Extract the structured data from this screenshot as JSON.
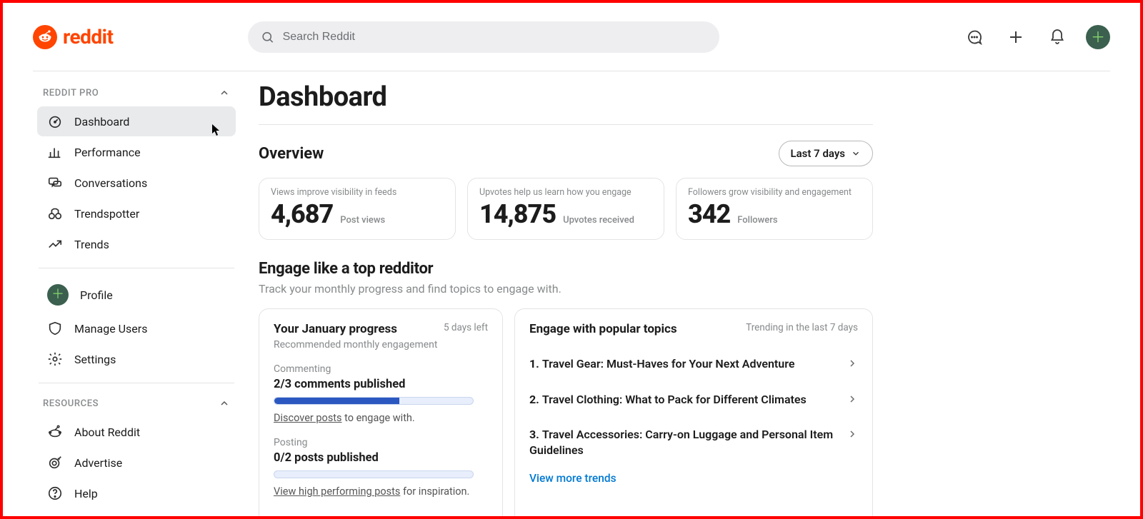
{
  "brand": {
    "name": "reddit"
  },
  "search": {
    "placeholder": "Search Reddit"
  },
  "sidebar": {
    "section_pro": "REDDIT PRO",
    "section_resources": "RESOURCES",
    "pro_items": [
      {
        "label": "Dashboard"
      },
      {
        "label": "Performance"
      },
      {
        "label": "Conversations"
      },
      {
        "label": "Trendspotter"
      },
      {
        "label": "Trends"
      }
    ],
    "account_items": [
      {
        "label": "Profile"
      },
      {
        "label": "Manage Users"
      },
      {
        "label": "Settings"
      }
    ],
    "resource_items": [
      {
        "label": "About Reddit"
      },
      {
        "label": "Advertise"
      },
      {
        "label": "Help"
      }
    ]
  },
  "page": {
    "title": "Dashboard"
  },
  "overview": {
    "title": "Overview",
    "range_label": "Last 7 days",
    "cards": [
      {
        "hint": "Views improve visibility in feeds",
        "value": "4,687",
        "unit": "Post views"
      },
      {
        "hint": "Upvotes help us learn how you engage",
        "value": "14,875",
        "unit": "Upvotes received"
      },
      {
        "hint": "Followers grow visibility and engagement",
        "value": "342",
        "unit": "Followers"
      }
    ]
  },
  "engage": {
    "title": "Engage like a top redditor",
    "subtitle": "Track your monthly progress and find topics to engage with."
  },
  "progress": {
    "title": "Your January progress",
    "days_left": "5 days left",
    "subtitle": "Recommended monthly engagement",
    "commenting": {
      "label": "Commenting",
      "value": "2/3 comments published",
      "percent": 63,
      "helper_link": "Discover posts",
      "helper_rest": " to engage with."
    },
    "posting": {
      "label": "Posting",
      "value": "0/2 posts published",
      "percent": 0,
      "helper_link": "View high performing posts",
      "helper_rest": " for inspiration."
    }
  },
  "topics": {
    "title": "Engage with popular topics",
    "meta": "Trending in the last 7 days",
    "items": [
      "Travel Gear: Must-Haves for Your Next Adventure",
      "Travel Clothing: What to Pack for Different Climates",
      "Travel Accessories: Carry-on Luggage and Personal Item Guidelines"
    ],
    "view_more": "View more trends"
  }
}
